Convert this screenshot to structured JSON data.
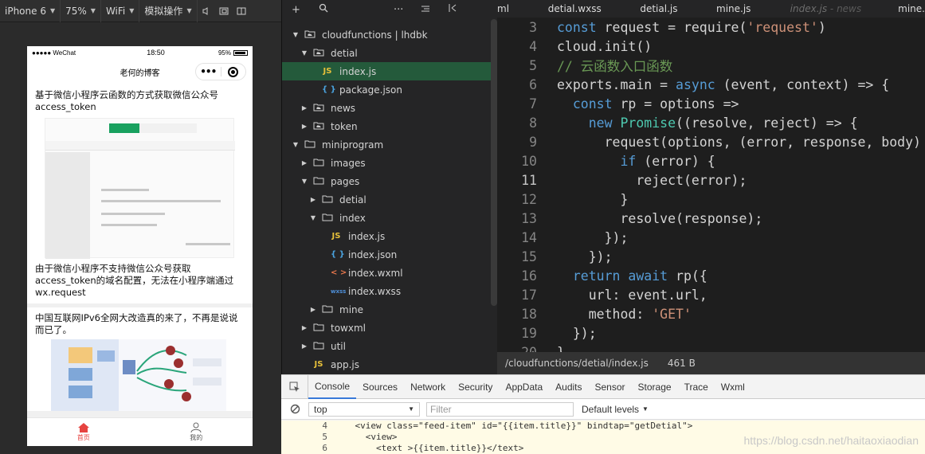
{
  "simulator": {
    "toolbar": {
      "device": "iPhone 6",
      "zoom": "75%",
      "network": "WiFi",
      "action": "模拟操作"
    },
    "status_bar": {
      "carrier": "●●●●● WeChat",
      "time": "18:50",
      "battery": "95%"
    },
    "nav_title": "老何的博客",
    "capsule_more": "•••",
    "feed": [
      {
        "title": "基于微信小程序云函数的方式获取微信公众号access_token",
        "subtitle": "由于微信小程序不支持微信公众号获取access_token的域名配置，无法在小程序端通过wx.request"
      },
      {
        "title": "中国互联网IPv6全网大改造真的来了，不再是说说而已了。"
      }
    ],
    "tabbar": [
      {
        "label": "首页",
        "active": true,
        "icon": "home-icon"
      },
      {
        "label": "我的",
        "active": false,
        "icon": "user-icon"
      }
    ],
    "colors": {
      "tab_active": "#e64340",
      "tab_inactive": "#555555"
    }
  },
  "file_tree": {
    "items": [
      {
        "label": "cloudfunctions | lhdbk",
        "type": "cloud-folder",
        "open": true,
        "depth": 0
      },
      {
        "label": "detial",
        "type": "cloud-folder",
        "open": true,
        "depth": 1
      },
      {
        "label": "index.js",
        "type": "js",
        "depth": 2,
        "selected": true
      },
      {
        "label": "package.json",
        "type": "json",
        "depth": 2
      },
      {
        "label": "news",
        "type": "cloud-folder",
        "open": false,
        "depth": 1
      },
      {
        "label": "token",
        "type": "cloud-folder",
        "open": false,
        "depth": 1
      },
      {
        "label": "miniprogram",
        "type": "folder",
        "open": true,
        "depth": 0
      },
      {
        "label": "images",
        "type": "folder",
        "open": false,
        "depth": 1
      },
      {
        "label": "pages",
        "type": "folder",
        "open": true,
        "depth": 1
      },
      {
        "label": "detial",
        "type": "folder",
        "open": false,
        "depth": 2
      },
      {
        "label": "index",
        "type": "folder",
        "open": true,
        "depth": 2
      },
      {
        "label": "index.js",
        "type": "js",
        "depth": 3
      },
      {
        "label": "index.json",
        "type": "json",
        "depth": 3
      },
      {
        "label": "index.wxml",
        "type": "wxml",
        "depth": 3
      },
      {
        "label": "index.wxss",
        "type": "wxss",
        "depth": 3
      },
      {
        "label": "mine",
        "type": "folder",
        "open": false,
        "depth": 2
      },
      {
        "label": "towxml",
        "type": "folder",
        "open": false,
        "depth": 1
      },
      {
        "label": "util",
        "type": "folder",
        "open": false,
        "depth": 1
      },
      {
        "label": "app.js",
        "type": "js",
        "depth": 1
      }
    ]
  },
  "editor": {
    "tabs": [
      {
        "label": "ml",
        "dim": false
      },
      {
        "label": "detial.wxss",
        "dim": false
      },
      {
        "label": "detial.js",
        "dim": false
      },
      {
        "label": "mine.js",
        "dim": false
      },
      {
        "label": "index.js",
        "suffix": " - news",
        "dim": true
      },
      {
        "label": "mine.",
        "dim": false
      }
    ],
    "lines": [
      {
        "n": "3"
      },
      {
        "n": "4"
      },
      {
        "n": "5"
      },
      {
        "n": "6"
      },
      {
        "n": "7"
      },
      {
        "n": "8"
      },
      {
        "n": "9"
      },
      {
        "n": "10"
      },
      {
        "n": "11",
        "current": true
      },
      {
        "n": "12"
      },
      {
        "n": "13"
      },
      {
        "n": "14"
      },
      {
        "n": "15"
      },
      {
        "n": "16"
      },
      {
        "n": "17"
      },
      {
        "n": "18"
      },
      {
        "n": "19"
      },
      {
        "n": "20"
      }
    ],
    "status": {
      "path": "/cloudfunctions/detial/index.js",
      "size": "461 B"
    }
  },
  "devtools": {
    "tabs": [
      "Console",
      "Sources",
      "Network",
      "Security",
      "AppData",
      "Audits",
      "Sensor",
      "Storage",
      "Trace",
      "Wxml"
    ],
    "active_tab": "Console",
    "context": "top",
    "filter_placeholder": "Filter",
    "levels": "Default levels",
    "console_lines": [
      {
        "n": "4",
        "text": "    <view class=\"feed-item\" id=\"{{item.title}}\" bindtap=\"getDetial\">"
      },
      {
        "n": "5",
        "text": "      <view>"
      },
      {
        "n": "6",
        "text": "        <text >{{item.title}}</text>"
      }
    ],
    "watermark": "https://blog.csdn.net/haitaoxiaodian"
  }
}
